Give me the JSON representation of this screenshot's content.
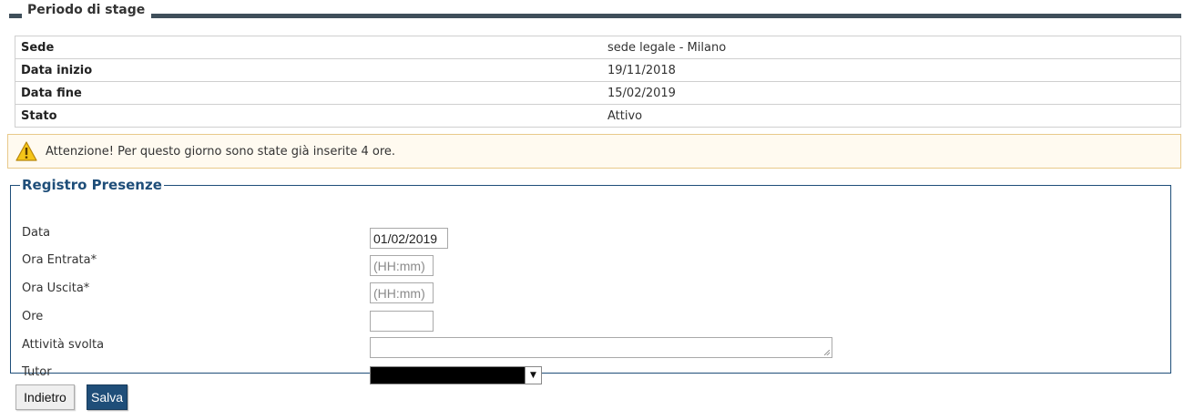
{
  "stage": {
    "title": "Periodo di stage",
    "rows": [
      {
        "label": "Sede",
        "value": "sede legale - Milano"
      },
      {
        "label": "Data inizio",
        "value": "19/11/2018"
      },
      {
        "label": "Data fine",
        "value": "15/02/2019"
      },
      {
        "label": "Stato",
        "value": "Attivo"
      }
    ]
  },
  "warning": {
    "icon": "warning-icon",
    "text": "Attenzione! Per questo giorno sono state già inserite 4 ore."
  },
  "registro": {
    "title": "Registro Presenze",
    "data_label": "Data",
    "data_value": "01/02/2019",
    "entrata_label": "Ora Entrata*",
    "entrata_placeholder": "(HH:mm)",
    "uscita_label": "Ora Uscita*",
    "uscita_placeholder": "(HH:mm)",
    "ore_label": "Ore",
    "ore_value": "",
    "attivita_label": "Attività svolta",
    "attivita_value": "",
    "tutor_label": "Tutor",
    "tutor_value": ""
  },
  "buttons": {
    "back": "Indietro",
    "save": "Salva"
  },
  "colors": {
    "accent": "#1f4e79",
    "section_rule": "#3f4f5a",
    "warning_border": "#e8c98a"
  }
}
